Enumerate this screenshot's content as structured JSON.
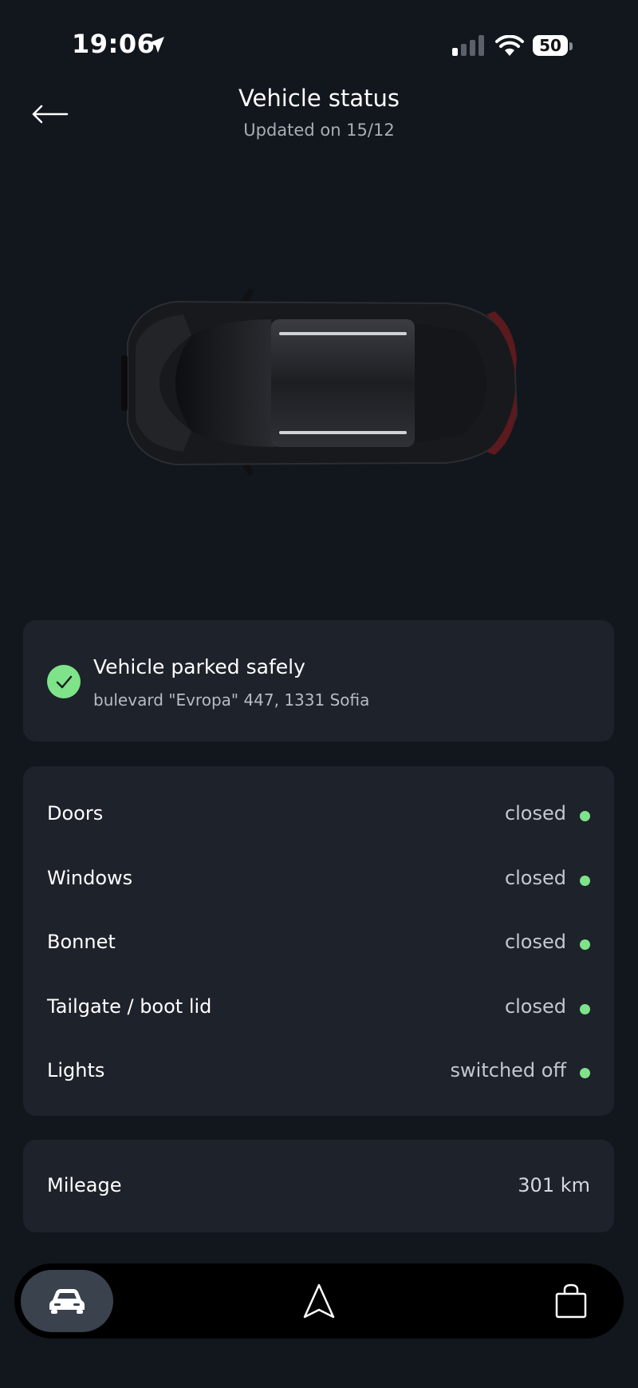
{
  "status_bar": {
    "time": "19:06",
    "battery": "50",
    "icons": [
      "location-arrow-icon",
      "signal-icon",
      "wifi-icon",
      "battery-icon"
    ]
  },
  "header": {
    "title": "Vehicle status",
    "subtitle": "Updated on 15/12"
  },
  "parked": {
    "title": "Vehicle parked safely",
    "address": "bulevard \"Evropa\" 447, 1331 Sofia"
  },
  "status_items": [
    {
      "label": "Doors",
      "value": "closed"
    },
    {
      "label": "Windows",
      "value": "closed"
    },
    {
      "label": "Bonnet",
      "value": "closed"
    },
    {
      "label": "Tailgate / boot lid",
      "value": "closed"
    },
    {
      "label": "Lights",
      "value": "switched off"
    }
  ],
  "mileage": {
    "label": "Mileage",
    "value": "301 km"
  },
  "nav": {
    "items": [
      "car-icon",
      "navigation-arrow-icon",
      "shopping-bag-icon"
    ]
  },
  "colors": {
    "background": "#12161d",
    "card": "#1e222b",
    "status_ok": "#7fe38a"
  }
}
